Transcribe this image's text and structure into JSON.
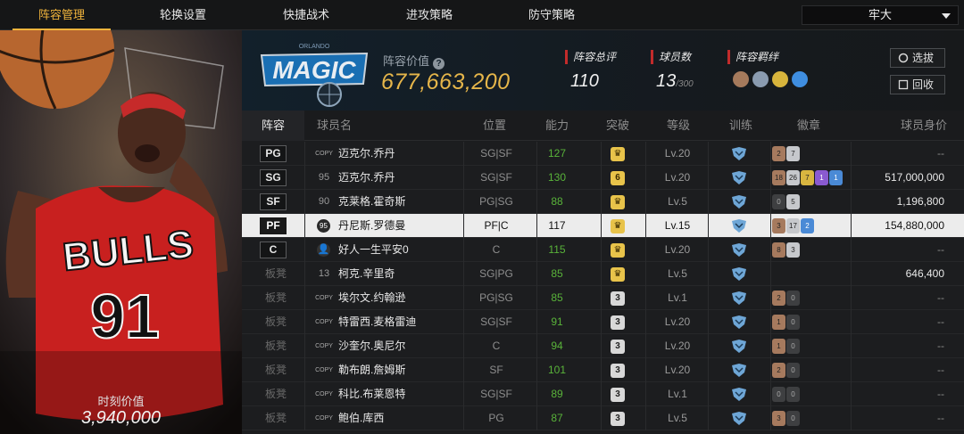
{
  "tabs": [
    "阵容管理",
    "轮换设置",
    "快捷战术",
    "进攻策略",
    "防守策略"
  ],
  "dropdown": {
    "selected": "牢大"
  },
  "card": {
    "jersey_team": "BULLS",
    "jersey_number": "91",
    "market_value_label": "时刻价值",
    "market_value": "3,940,000"
  },
  "summary": {
    "team_value_label": "阵容价值",
    "team_value": "677,663,200",
    "overall_label": "阵容总评",
    "overall_value": "110",
    "players_label": "球员数",
    "players_value": "13",
    "players_max": "/300",
    "bond_label": "阵容羁绊",
    "btn_select": "选拔",
    "btn_recycle": "回收"
  },
  "table": {
    "headers": [
      "阵容",
      "球员名",
      "位置",
      "能力",
      "突破",
      "等级",
      "训练",
      "徽章",
      "球员身价"
    ],
    "rows": [
      {
        "slot": "PG",
        "num": "COPY",
        "name": "迈克尔.乔丹",
        "position": "SG|SF",
        "ability": "127",
        "break": "crown",
        "level": "Lv.20",
        "medals": [
          [
            "bronze",
            "2"
          ],
          [
            "silver",
            "7"
          ]
        ],
        "value": "--"
      },
      {
        "slot": "SG",
        "num": "95",
        "name": "迈克尔.乔丹",
        "position": "SG|SF",
        "ability": "130",
        "break": "6",
        "level": "Lv.20",
        "medals": [
          [
            "bronze",
            "18"
          ],
          [
            "silver",
            "26"
          ],
          [
            "gold",
            "7"
          ],
          [
            "purple",
            "1"
          ],
          [
            "blue",
            "1"
          ]
        ],
        "value": "517,000,000"
      },
      {
        "slot": "SF",
        "num": "90",
        "name": "克莱格.霍奇斯",
        "position": "PG|SG",
        "ability": "88",
        "break": "crown",
        "level": "Lv.5",
        "medals": [
          [
            "dark",
            "0"
          ],
          [
            "silver",
            "5"
          ]
        ],
        "value": "1,196,800"
      },
      {
        "slot": "PF",
        "num": "95",
        "name": "丹尼斯.罗德曼",
        "position": "PF|C",
        "ability": "117",
        "break": "crown",
        "level": "Lv.15",
        "medals": [
          [
            "bronze",
            "3"
          ],
          [
            "silver",
            "17"
          ],
          [
            "blue",
            "2"
          ]
        ],
        "value": "154,880,000",
        "selected": true
      },
      {
        "slot": "C",
        "num": "person",
        "name": "好人一生平安0",
        "position": "C",
        "ability": "115",
        "break": "crown",
        "level": "Lv.20",
        "medals": [
          [
            "bronze",
            "8"
          ],
          [
            "silver",
            "3"
          ]
        ],
        "value": "--"
      },
      {
        "slot": "板凳",
        "num": "13",
        "name": "柯克.辛里奇",
        "position": "SG|PG",
        "ability": "85",
        "break": "crown",
        "level": "Lv.5",
        "medals": [],
        "value": "646,400"
      },
      {
        "slot": "板凳",
        "num": "COPY",
        "name": "埃尔文.约翰逊",
        "position": "PG|SG",
        "ability": "85",
        "break": "3",
        "level": "Lv.1",
        "medals": [
          [
            "bronze",
            "2"
          ],
          [
            "dark",
            "0"
          ]
        ],
        "value": "--"
      },
      {
        "slot": "板凳",
        "num": "COPY",
        "name": "特雷西.麦格雷迪",
        "position": "SG|SF",
        "ability": "91",
        "break": "3",
        "level": "Lv.20",
        "medals": [
          [
            "bronze",
            "1"
          ],
          [
            "dark",
            "0"
          ]
        ],
        "value": "--"
      },
      {
        "slot": "板凳",
        "num": "COPY",
        "name": "沙奎尔.奥尼尔",
        "position": "C",
        "ability": "94",
        "break": "3",
        "level": "Lv.20",
        "medals": [
          [
            "bronze",
            "1"
          ],
          [
            "dark",
            "0"
          ]
        ],
        "value": "--"
      },
      {
        "slot": "板凳",
        "num": "COPY",
        "name": "勒布朗.詹姆斯",
        "position": "SF",
        "ability": "101",
        "break": "3",
        "level": "Lv.20",
        "medals": [
          [
            "bronze",
            "2"
          ],
          [
            "dark",
            "0"
          ]
        ],
        "value": "--"
      },
      {
        "slot": "板凳",
        "num": "COPY",
        "name": "科比.布莱恩特",
        "position": "SG|SF",
        "ability": "89",
        "break": "3",
        "level": "Lv.1",
        "medals": [
          [
            "dark",
            "0"
          ],
          [
            "dark",
            "0"
          ]
        ],
        "value": "--"
      },
      {
        "slot": "板凳",
        "num": "COPY",
        "name": "鲍伯.库西",
        "position": "PG",
        "ability": "87",
        "break": "3",
        "level": "Lv.5",
        "medals": [
          [
            "bronze",
            "3"
          ],
          [
            "dark",
            "0"
          ]
        ],
        "value": "--"
      }
    ]
  },
  "colors": {
    "accent": "#f0b43c",
    "ability_green": "#59b33a",
    "value_gold": "#e6b64a"
  }
}
